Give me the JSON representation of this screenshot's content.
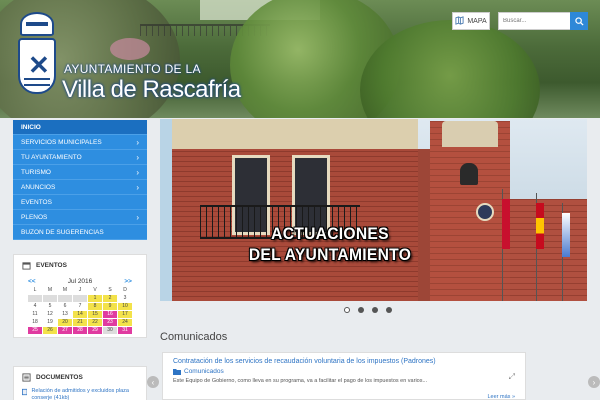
{
  "header": {
    "site_name_top": "AYUNTAMIENTO DE LA",
    "site_name_bottom": "Villa de Rascafría",
    "mapa_label": "MAPA",
    "search_placeholder": "Buscar...",
    "icons": {
      "map": "map-icon",
      "search": "search-icon",
      "crest": "crest-logo"
    }
  },
  "nav": {
    "items": [
      {
        "label": "INICIO",
        "active": true,
        "has_submenu": false
      },
      {
        "label": "SERVICIOS MUNICIPALES",
        "has_submenu": true
      },
      {
        "label": "TU AYUNTAMIENTO",
        "has_submenu": true
      },
      {
        "label": "TURISMO",
        "has_submenu": true
      },
      {
        "label": "ANUNCIOS",
        "has_submenu": true
      },
      {
        "label": "EVENTOS",
        "has_submenu": false
      },
      {
        "label": "PLENOS",
        "has_submenu": true
      },
      {
        "label": "BUZON DE SUGERENCIAS",
        "has_submenu": false
      }
    ],
    "chevron": "›"
  },
  "events": {
    "title": "EVENTOS",
    "prev": "<<",
    "next": ">>",
    "month": "Jul 2016",
    "weekdays": [
      "L",
      "M",
      "M",
      "J",
      "V",
      "S",
      "D"
    ],
    "days": [
      {
        "d": "",
        "s": "g"
      },
      {
        "d": "",
        "s": "g"
      },
      {
        "d": "",
        "s": "g"
      },
      {
        "d": "",
        "s": "g"
      },
      {
        "d": "1",
        "s": "y"
      },
      {
        "d": "2",
        "s": "y"
      },
      {
        "d": "3",
        "s": ""
      },
      {
        "d": "4",
        "s": ""
      },
      {
        "d": "5",
        "s": ""
      },
      {
        "d": "6",
        "s": ""
      },
      {
        "d": "7",
        "s": ""
      },
      {
        "d": "8",
        "s": "y"
      },
      {
        "d": "9",
        "s": "y"
      },
      {
        "d": "10",
        "s": "y"
      },
      {
        "d": "11",
        "s": ""
      },
      {
        "d": "12",
        "s": ""
      },
      {
        "d": "13",
        "s": ""
      },
      {
        "d": "14",
        "s": "y"
      },
      {
        "d": "15",
        "s": "y"
      },
      {
        "d": "16",
        "s": "m"
      },
      {
        "d": "17",
        "s": "y"
      },
      {
        "d": "18",
        "s": ""
      },
      {
        "d": "19",
        "s": ""
      },
      {
        "d": "20",
        "s": "y"
      },
      {
        "d": "21",
        "s": "y"
      },
      {
        "d": "22",
        "s": "y"
      },
      {
        "d": "23",
        "s": "m"
      },
      {
        "d": "24",
        "s": "y"
      },
      {
        "d": "25",
        "s": "m"
      },
      {
        "d": "26",
        "s": "y"
      },
      {
        "d": "27",
        "s": "m"
      },
      {
        "d": "28",
        "s": "m"
      },
      {
        "d": "29",
        "s": "m"
      },
      {
        "d": "30",
        "s": "g"
      },
      {
        "d": "31",
        "s": "m"
      }
    ]
  },
  "documents": {
    "title": "DOCUMENTOS",
    "items": [
      {
        "label": "Relación de admitidos y excluidos plaza conserje (41kb)"
      }
    ]
  },
  "slider": {
    "caption_line1": "ACTUACIONES",
    "caption_line2": "DEL AYUNTAMIENTO",
    "dot_count": 4,
    "active_dot": 0
  },
  "comunicados": {
    "title": "Comunicados",
    "prev_arrow": "‹",
    "next_arrow": "›",
    "card": {
      "headline": "Contratación de los servicios de recaudación voluntaria de los impuestos (Padrones)",
      "category": "Comunicados",
      "excerpt": "Este Equipo de Gobierno, como lleva en su programa, va a facilitar el pago de los impuestos en varios...",
      "read_more": "Leer más »"
    }
  },
  "colors": {
    "nav_bg": "#2e8ee0",
    "nav_active": "#1b6fc0",
    "link": "#2e74c4",
    "event_yellow": "#f3e24a",
    "event_magenta": "#e03ba0"
  }
}
